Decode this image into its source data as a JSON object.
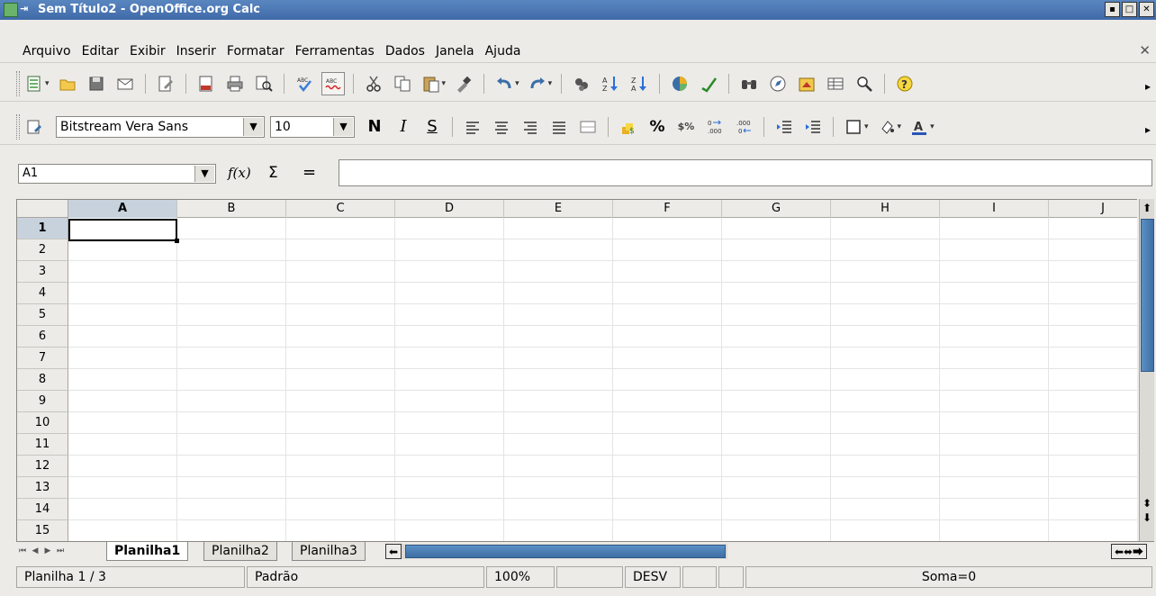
{
  "window": {
    "title": "Sem Título2 - OpenOffice.org Calc",
    "pin_glyph": "⇥",
    "controls": [
      "▪",
      "□",
      "✕"
    ]
  },
  "menu": {
    "items": [
      "Arquivo",
      "Editar",
      "Exibir",
      "Inserir",
      "Formatar",
      "Ferramentas",
      "Dados",
      "Janela",
      "Ajuda"
    ],
    "close_glyph": "✕"
  },
  "standard_toolbar": {
    "icons": [
      "new-icon",
      "open-icon",
      "save-icon",
      "email-icon",
      "edit-file-icon",
      "export-pdf-icon",
      "print-icon",
      "page-preview-icon",
      "spellcheck-icon",
      "autospellcheck-icon",
      "cut-icon",
      "copy-icon",
      "paste-icon",
      "format-paintbrush-icon",
      "undo-icon",
      "redo-icon",
      "hyperlink-icon",
      "sort-ascending-icon",
      "sort-descending-icon",
      "chart-icon",
      "draw-functions-icon",
      "find-replace-icon",
      "navigator-icon",
      "gallery-icon",
      "data-sources-icon",
      "zoom-icon",
      "help-icon"
    ]
  },
  "formatting_toolbar": {
    "font_name": "Bitstream Vera Sans",
    "font_size": "10",
    "bold": "N",
    "italic": "I",
    "underline": "S",
    "percent": "%",
    "currency": "$%"
  },
  "formula_bar": {
    "name_box": "A1",
    "function_wizard": "f(x)",
    "sum": "Σ",
    "equals": "=",
    "formula": ""
  },
  "sheet": {
    "columns": [
      "A",
      "B",
      "C",
      "D",
      "E",
      "F",
      "G",
      "H",
      "I",
      "J"
    ],
    "rows": [
      "1",
      "2",
      "3",
      "4",
      "5",
      "6",
      "7",
      "8",
      "9",
      "10",
      "11",
      "12",
      "13",
      "14",
      "15"
    ],
    "active_cell": "A1"
  },
  "tabs": [
    "Planilha1",
    "Planilha2",
    "Planilha3"
  ],
  "active_tab": "Planilha1",
  "status": {
    "sheet_pos": "Planilha 1 / 3",
    "page_style": "Padrão",
    "zoom": "100%",
    "insert_mode": "",
    "selection_mode": "DESV",
    "extra1": "",
    "extra2": "",
    "sum": "Soma=0"
  }
}
